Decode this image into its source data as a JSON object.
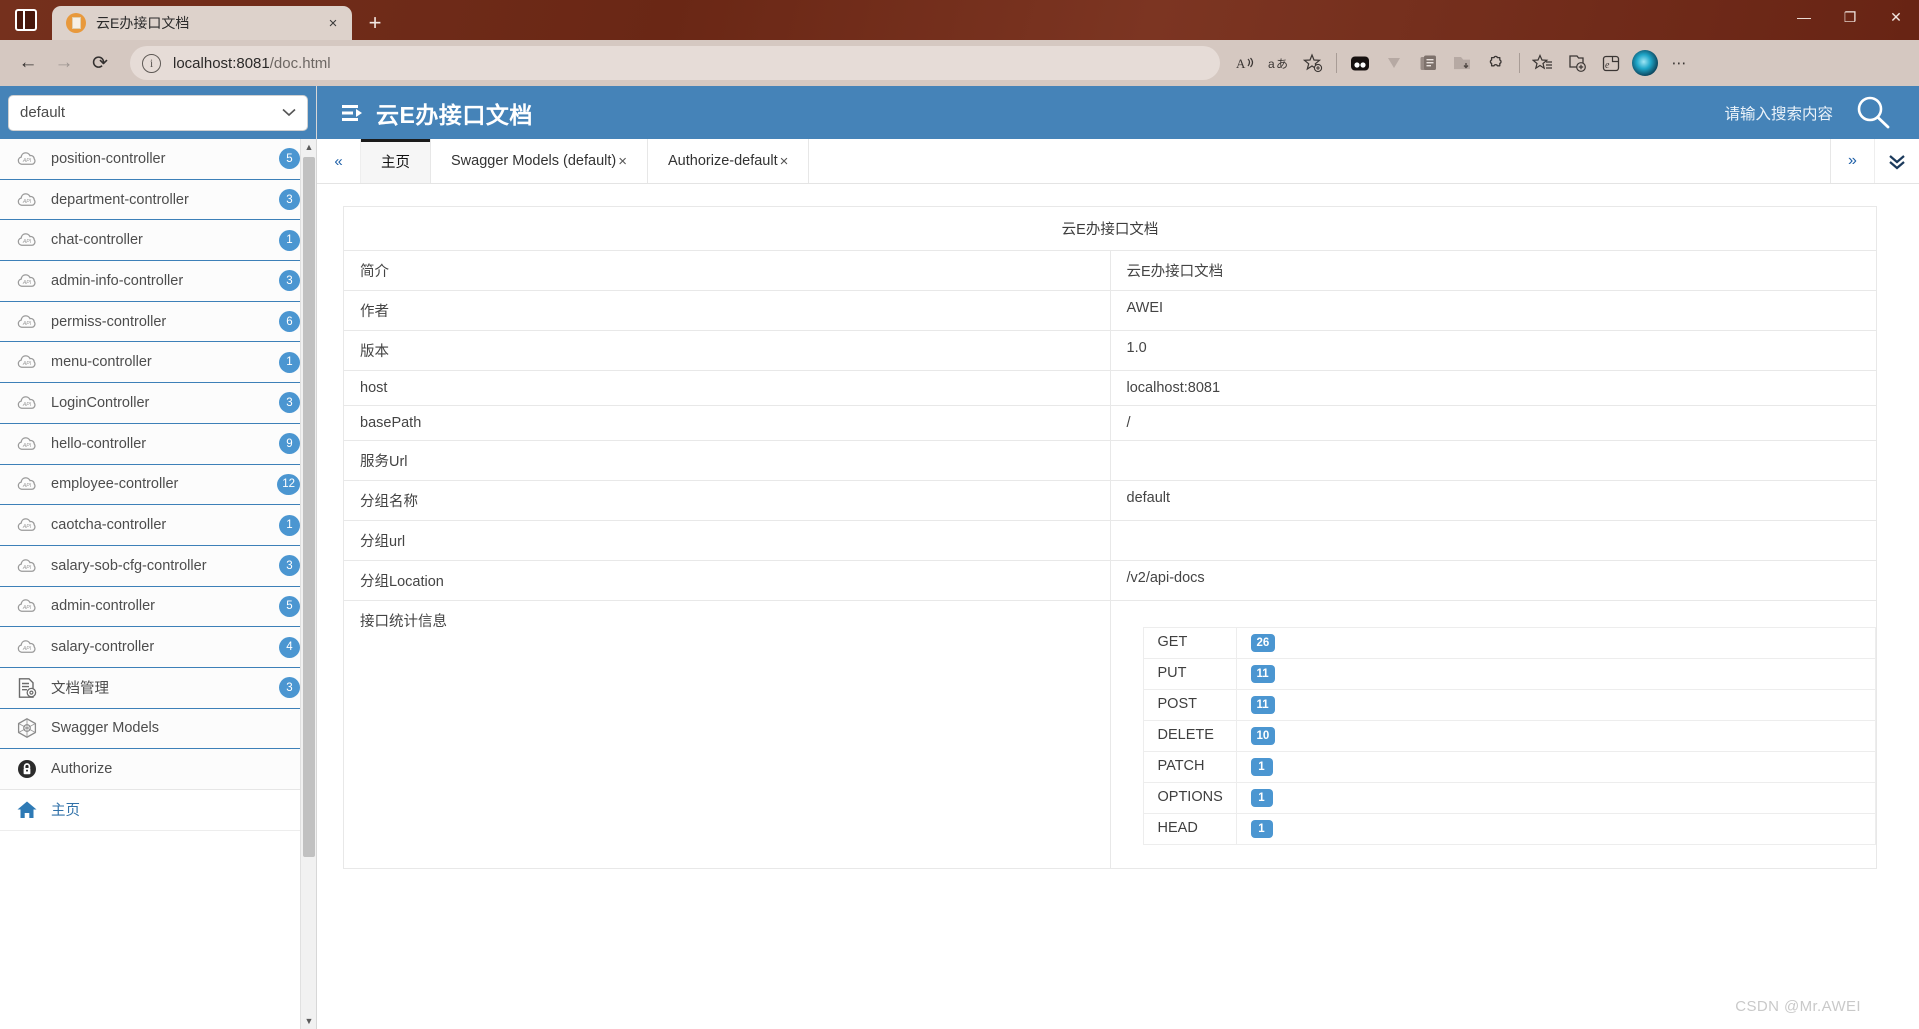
{
  "browser": {
    "tab_title": "云E办接口文档",
    "tab_close": "×",
    "new_tab": "+",
    "back": "←",
    "forward": "→",
    "reload": "⟳",
    "url_host": "localhost:8081",
    "url_path": "/doc.html",
    "url_info_icon": "i",
    "minimize": "—",
    "maximize": "❐",
    "close": "✕",
    "toolbar_icons": [
      {
        "name": "read-aloud-icon",
        "glyph": "A⁾"
      },
      {
        "name": "translate-icon",
        "glyph": "aあ"
      },
      {
        "name": "add-favorite-icon",
        "glyph": "☆"
      },
      {
        "name": "split-screen-icon",
        "glyph": "◗◖"
      },
      {
        "name": "downloads-icon",
        "glyph": "⌄"
      },
      {
        "name": "collections-icon",
        "glyph": "❐"
      },
      {
        "name": "browser-essentials-icon",
        "glyph": "⬓"
      },
      {
        "name": "extensions-icon",
        "glyph": "✣"
      },
      {
        "name": "favorites-icon",
        "glyph": "☆"
      },
      {
        "name": "add-tab-group-icon",
        "glyph": "⊕"
      },
      {
        "name": "copilot-icon",
        "glyph": "ℯ"
      }
    ],
    "more_options": "⋯"
  },
  "sidebar": {
    "group_selector": {
      "value": "default",
      "chevron": "⌄"
    },
    "items": [
      {
        "label": "主页",
        "icon": "home-icon",
        "badge": ""
      },
      {
        "label": "Authorize",
        "icon": "lock-icon",
        "badge": ""
      },
      {
        "label": "Swagger Models",
        "icon": "model-icon",
        "badge": ""
      },
      {
        "label": "文档管理",
        "icon": "doc-gear-icon",
        "badge": "3"
      },
      {
        "label": "salary-controller",
        "icon": "api-cloud-icon",
        "badge": "4"
      },
      {
        "label": "admin-controller",
        "icon": "api-cloud-icon",
        "badge": "5"
      },
      {
        "label": "salary-sob-cfg-controller",
        "icon": "api-cloud-icon",
        "badge": "3"
      },
      {
        "label": "caotcha-controller",
        "icon": "api-cloud-icon",
        "badge": "1"
      },
      {
        "label": "employee-controller",
        "icon": "api-cloud-icon",
        "badge": "12"
      },
      {
        "label": "hello-controller",
        "icon": "api-cloud-icon",
        "badge": "9"
      },
      {
        "label": "LoginController",
        "icon": "api-cloud-icon",
        "badge": "3"
      },
      {
        "label": "menu-controller",
        "icon": "api-cloud-icon",
        "badge": "1"
      },
      {
        "label": "permiss-controller",
        "icon": "api-cloud-icon",
        "badge": "6"
      },
      {
        "label": "admin-info-controller",
        "icon": "api-cloud-icon",
        "badge": "3"
      },
      {
        "label": "chat-controller",
        "icon": "api-cloud-icon",
        "badge": "1"
      },
      {
        "label": "department-controller",
        "icon": "api-cloud-icon",
        "badge": "3"
      },
      {
        "label": "position-controller",
        "icon": "api-cloud-icon",
        "badge": "5"
      }
    ],
    "scroll_up": "▲",
    "scroll_down": "▼"
  },
  "header": {
    "menu_icon": "list-toggle-icon",
    "title": "云E办接口文档",
    "search_placeholder": "请输入搜索内容",
    "search_icon": "search-icon"
  },
  "tabstrip": {
    "collapse": "«",
    "tabs": [
      {
        "label": "主页",
        "closable": false,
        "active": true
      },
      {
        "label": "Swagger Models (default)",
        "close": "×",
        "closable": true,
        "active": false
      },
      {
        "label": "Authorize-default",
        "close": "×",
        "closable": true,
        "active": false
      }
    ],
    "more": "»",
    "expand": "⌄⌄"
  },
  "content": {
    "doc_title": "云E办接口文档",
    "rows": [
      {
        "key": "简介",
        "value": "云E办接口文档"
      },
      {
        "key": "作者",
        "value": "AWEI"
      },
      {
        "key": "版本",
        "value": "1.0"
      },
      {
        "key": "host",
        "value": "localhost:8081"
      },
      {
        "key": "basePath",
        "value": "/"
      },
      {
        "key": "服务Url",
        "value": ""
      },
      {
        "key": "分组名称",
        "value": "default"
      },
      {
        "key": "分组url",
        "value": ""
      },
      {
        "key": "分组Location",
        "value": "/v2/api-docs"
      },
      {
        "key": "接口统计信息",
        "value": ""
      }
    ],
    "stats": [
      {
        "method": "GET",
        "count": "26"
      },
      {
        "method": "PUT",
        "count": "11"
      },
      {
        "method": "POST",
        "count": "11"
      },
      {
        "method": "DELETE",
        "count": "10"
      },
      {
        "method": "PATCH",
        "count": "1"
      },
      {
        "method": "OPTIONS",
        "count": "1"
      },
      {
        "method": "HEAD",
        "count": "1"
      }
    ]
  },
  "watermark": "CSDN @Mr.AWEI",
  "colors": {
    "header_blue": "#4583b8",
    "badge_blue": "#4b96d1",
    "titlebar": "#6e2a18",
    "toolbar": "#d5c8c1",
    "link_blue": "#3071a9"
  },
  "chart_data": {
    "type": "bar",
    "title": "接口统计信息",
    "categories": [
      "GET",
      "PUT",
      "POST",
      "DELETE",
      "PATCH",
      "OPTIONS",
      "HEAD"
    ],
    "values": [
      26,
      11,
      11,
      10,
      1,
      1,
      1
    ],
    "xlabel": "",
    "ylabel": "",
    "ylim": [
      0,
      26
    ]
  }
}
